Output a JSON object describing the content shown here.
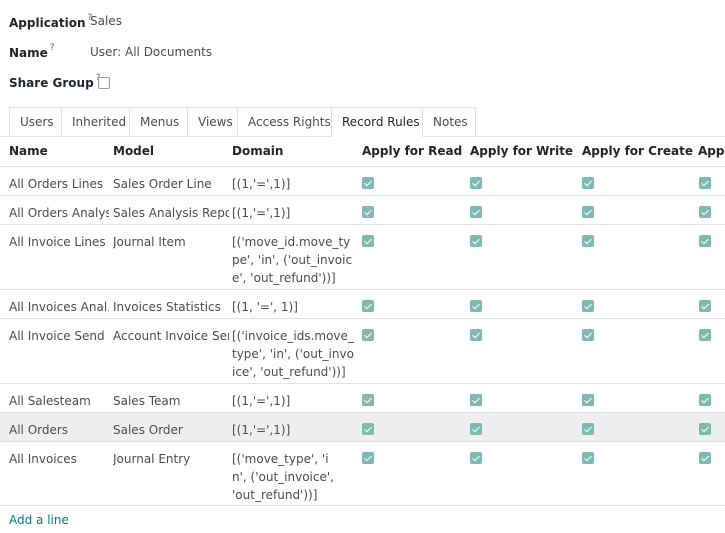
{
  "form": {
    "application_label": "Application",
    "application_value": "Sales",
    "name_label": "Name",
    "name_value": "User: All Documents",
    "share_group_label": "Share Group",
    "help_mark": "?"
  },
  "tabs": [
    {
      "label": "Users",
      "active": false
    },
    {
      "label": "Inherited",
      "active": false
    },
    {
      "label": "Menus",
      "active": false
    },
    {
      "label": "Views",
      "active": false
    },
    {
      "label": "Access Rights",
      "active": false
    },
    {
      "label": "Record Rules",
      "active": true
    },
    {
      "label": "Notes",
      "active": false
    }
  ],
  "table": {
    "headers": [
      "Name",
      "Model",
      "Domain",
      "Apply for Read",
      "Apply for Write",
      "Apply for Create",
      "Apply for Delete"
    ],
    "rows": [
      {
        "name": "All Orders Lines",
        "model": "Sales Order Line",
        "domain": "[(1,'=',1)]",
        "read": true,
        "write": true,
        "create": true,
        "delete": true
      },
      {
        "name": "All Orders Analysis",
        "model": "Sales Analysis Report",
        "domain": "[(1,'=',1)]",
        "read": true,
        "write": true,
        "create": true,
        "delete": true
      },
      {
        "name": "All Invoice Lines",
        "model": "Journal Item",
        "domain": "[('move_id.move_type', 'in', ('out_invoice', 'out_refund'))]",
        "read": true,
        "write": true,
        "create": true,
        "delete": true
      },
      {
        "name": "All Invoices Anal…",
        "model": "Invoices Statistics",
        "domain": "[(1, '=', 1)]",
        "read": true,
        "write": true,
        "create": true,
        "delete": true
      },
      {
        "name": "All Invoice Send …",
        "model": "Account Invoice Send",
        "domain": "[('invoice_ids.move_type', 'in', ('out_invoice', 'out_refund'))]",
        "read": true,
        "write": true,
        "create": true,
        "delete": true
      },
      {
        "name": "All Salesteam",
        "model": "Sales Team",
        "domain": "[(1,'=',1)]",
        "read": true,
        "write": true,
        "create": true,
        "delete": true
      },
      {
        "name": "All Orders",
        "model": "Sales Order",
        "domain": "[(1,'=',1)]",
        "read": true,
        "write": true,
        "create": true,
        "delete": true
      },
      {
        "name": "All Invoices",
        "model": "Journal Entry",
        "domain": "[('move_type', 'in', ('out_invoice', 'out_refund'))]",
        "read": true,
        "write": true,
        "create": true,
        "delete": true
      }
    ]
  },
  "add_line_label": "Add a line",
  "colors": {
    "accent": "#017e84",
    "checkbox": "#7fb9b3",
    "highlight_row": "#efefef",
    "border": "#dee2e6"
  }
}
